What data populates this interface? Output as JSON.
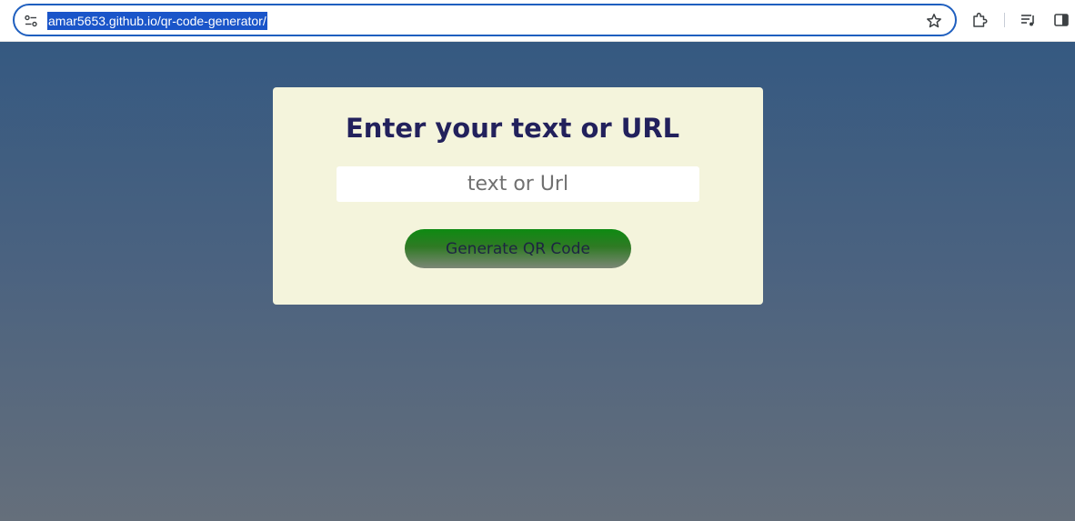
{
  "browser": {
    "url": "amar5653.github.io/qr-code-generator/",
    "icons": [
      "site-info-icon",
      "star-icon",
      "extensions-icon",
      "media-controls-icon",
      "side-panel-icon"
    ]
  },
  "card": {
    "heading": "Enter your text or URL",
    "input": {
      "placeholder": "text or Url",
      "value": ""
    },
    "button_label": "Generate QR Code"
  },
  "colors": {
    "page_gradient_top": "#355981",
    "page_gradient_bottom": "#656f7b",
    "card_background": "#f4f4dc",
    "heading_color": "#22215c",
    "button_green": "#0e8a12",
    "url_highlight": "#1a55c9"
  }
}
